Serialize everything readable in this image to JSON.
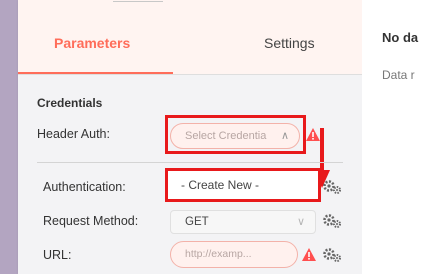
{
  "tabs": {
    "parameters": "Parameters",
    "settings": "Settings"
  },
  "section": {
    "credentials": "Credentials"
  },
  "fields": {
    "header_auth_label": "Header Auth:",
    "credential_placeholder": "Select Credentia",
    "create_new": "- Create New -",
    "authentication_label": "Authentication:",
    "request_method_label": "Request Method:",
    "request_method_value": "GET",
    "url_label": "URL:",
    "url_placeholder": "http://examp..."
  },
  "right_pane": {
    "title": "No da",
    "text": "Data r"
  },
  "colors": {
    "accent": "#ff6d5a",
    "highlight": "#e8191b",
    "warning": "#ff4f4f"
  }
}
